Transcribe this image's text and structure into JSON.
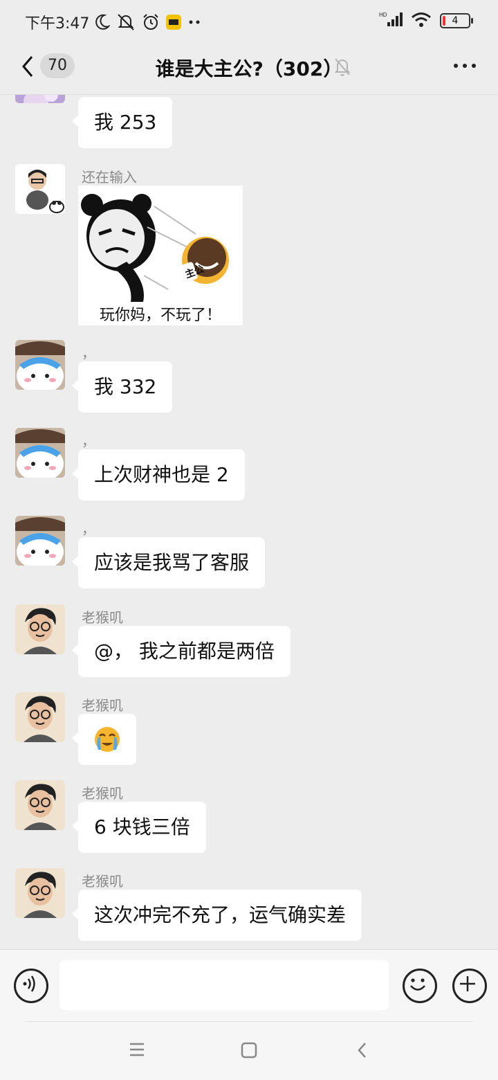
{
  "status_bar": {
    "time": "下午3:47",
    "battery_level": "4",
    "signal_label": "HD"
  },
  "header": {
    "unread_count": "70",
    "title": "谁是大主公?（302）"
  },
  "messages": [
    {
      "sender": "",
      "text": "我 253",
      "avatar": "anime-avatar"
    },
    {
      "sender": "还在输入",
      "sticker_caption": "玩你妈，不玩了！",
      "sticker_badge": "主公",
      "avatar": "man-cartoon-avatar"
    },
    {
      "sender": "，",
      "text": "我 332",
      "avatar": "plush-toy-avatar"
    },
    {
      "sender": "，",
      "text": "上次财神也是 2",
      "avatar": "plush-toy-avatar"
    },
    {
      "sender": "，",
      "text": "应该是我骂了客服",
      "avatar": "plush-toy-avatar"
    },
    {
      "sender": "老猴叽",
      "text": "@，   我之前都是两倍",
      "avatar": "glasses-man-avatar"
    },
    {
      "sender": "老猴叽",
      "text": "😭",
      "avatar": "glasses-man-avatar"
    },
    {
      "sender": "老猴叽",
      "text": "6 块钱三倍",
      "avatar": "glasses-man-avatar"
    },
    {
      "sender": "老猴叽",
      "text": "这次冲完不充了，运气确实差",
      "avatar": "glasses-man-avatar"
    }
  ],
  "composer": {
    "placeholder": ""
  },
  "icons": [
    "back-icon",
    "mute-bell-icon",
    "more-icon",
    "voice-icon",
    "emoji-icon",
    "plus-icon",
    "menu-nav-icon",
    "home-nav-icon",
    "back-nav-icon"
  ]
}
